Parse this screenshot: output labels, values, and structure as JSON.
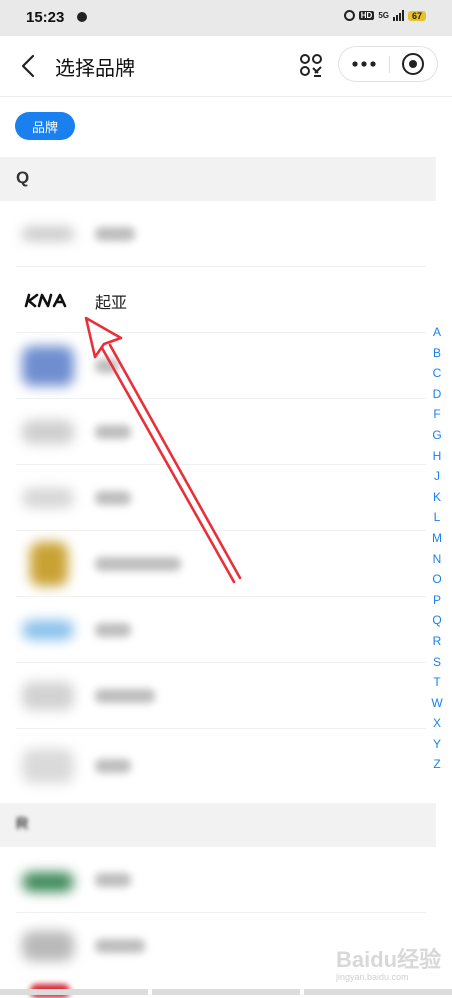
{
  "status_bar": {
    "time": "15:23",
    "network": "5G",
    "battery": "67"
  },
  "nav": {
    "title": "选择品牌"
  },
  "filter_chip": {
    "label": "品牌"
  },
  "sections": [
    {
      "letter": "Q"
    },
    {
      "letter": "R"
    }
  ],
  "selected_brand": {
    "name": "起亚"
  },
  "alphabet_index": [
    "A",
    "B",
    "C",
    "D",
    "F",
    "G",
    "H",
    "J",
    "K",
    "L",
    "M",
    "N",
    "O",
    "P",
    "Q",
    "R",
    "S",
    "T",
    "W",
    "X",
    "Y",
    "Z"
  ],
  "watermark": {
    "text": "Baidu经验",
    "sub": "jingyan.baidu.com"
  },
  "colors": {
    "accent": "#1a80f0",
    "arrow": "#e8303a"
  }
}
